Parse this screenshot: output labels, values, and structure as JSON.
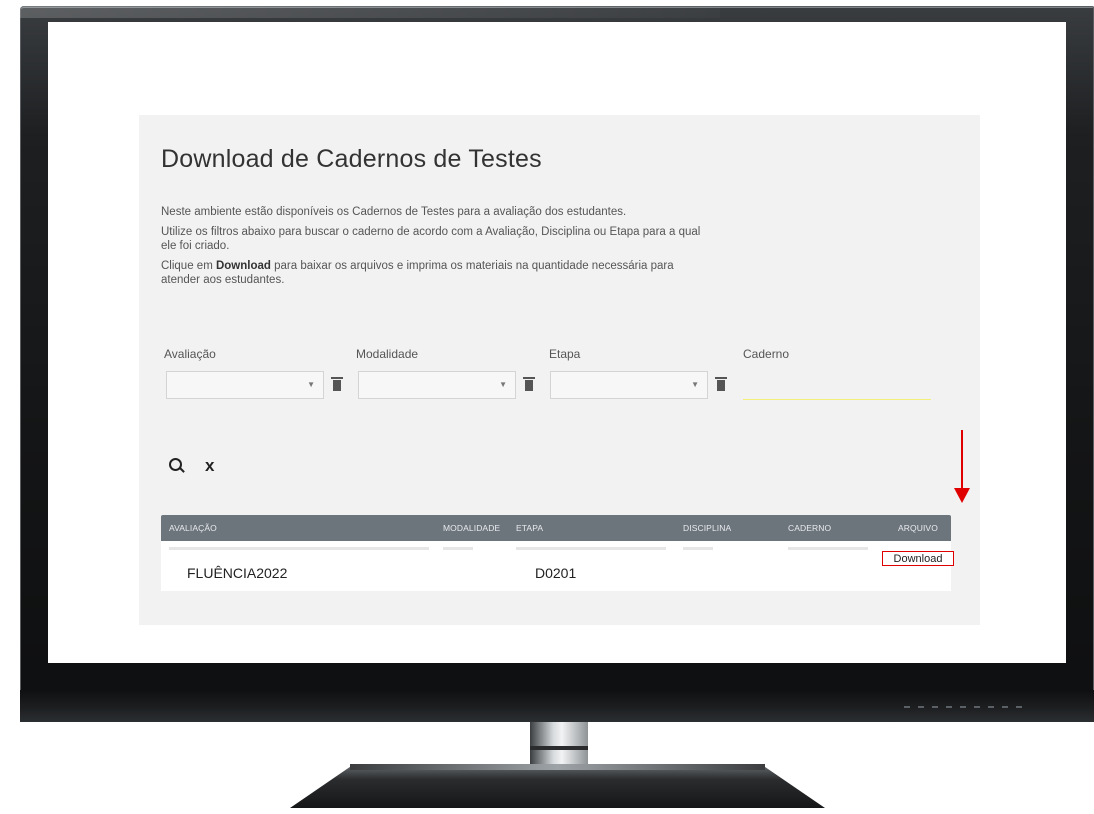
{
  "page": {
    "title": "Download de Cadernos de Testes",
    "intro_1": "Neste ambiente estão disponíveis os Cadernos de Testes para a avaliação dos estudantes.",
    "intro_2": "Utilize os filtros abaixo para buscar o caderno de acordo com a Avaliação, Disciplina ou Etapa para a qual ele foi criado.",
    "intro_3_prefix": "Clique em ",
    "intro_3_bold": "Download",
    "intro_3_suffix": " para baixar os arquivos e imprima os materiais na quantidade necessária para atender aos estudantes."
  },
  "filters": {
    "avaliacao_label": "Avaliação",
    "modalidade_label": "Modalidade",
    "etapa_label": "Etapa",
    "caderno_label": "Caderno",
    "avaliacao_value": "",
    "modalidade_value": "",
    "etapa_value": "",
    "caderno_value": ""
  },
  "actions": {
    "search_icon": "search-icon",
    "clear_icon": "close-icon",
    "clear_glyph": "x"
  },
  "table": {
    "headers": [
      "AVALIAÇÃO",
      "MODALIDADE",
      "ETAPA",
      "DISCIPLINA",
      "CADERNO",
      "ARQUIVO"
    ],
    "rows": [
      {
        "avaliacao": "FLUÊNCIA2022",
        "etapa": "D0201",
        "download_label": "Download"
      }
    ]
  },
  "colors": {
    "panel_bg": "#f2f2f2",
    "header_bg": "#6c747c",
    "annotation_red": "#e00000",
    "input_underline": "#f3f07a"
  }
}
